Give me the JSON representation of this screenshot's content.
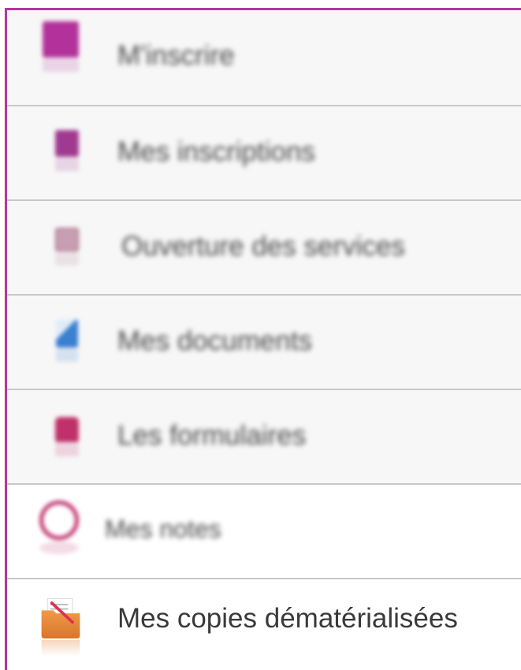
{
  "menu": {
    "items": [
      {
        "label": "M'inscrire",
        "icon": "register-icon",
        "color": "#b3319a"
      },
      {
        "label": "Mes inscriptions",
        "icon": "inscriptions-icon",
        "color": "#a03a90"
      },
      {
        "label": "Ouverture des services",
        "icon": "services-icon",
        "color": "#b08090"
      },
      {
        "label": "Mes documents",
        "icon": "documents-icon",
        "color": "#3a7fd0"
      },
      {
        "label": "Les formulaires",
        "icon": "forms-icon",
        "color": "#c0306a"
      },
      {
        "label": "Mes notes",
        "icon": "notes-icon",
        "color": "#c0356e"
      },
      {
        "label": "Mes copies dématérialisées",
        "icon": "folder-icon",
        "color": "#e28a3e"
      }
    ]
  },
  "colors": {
    "frame_border": "#b03a96",
    "divider": "#c8c8c8"
  }
}
